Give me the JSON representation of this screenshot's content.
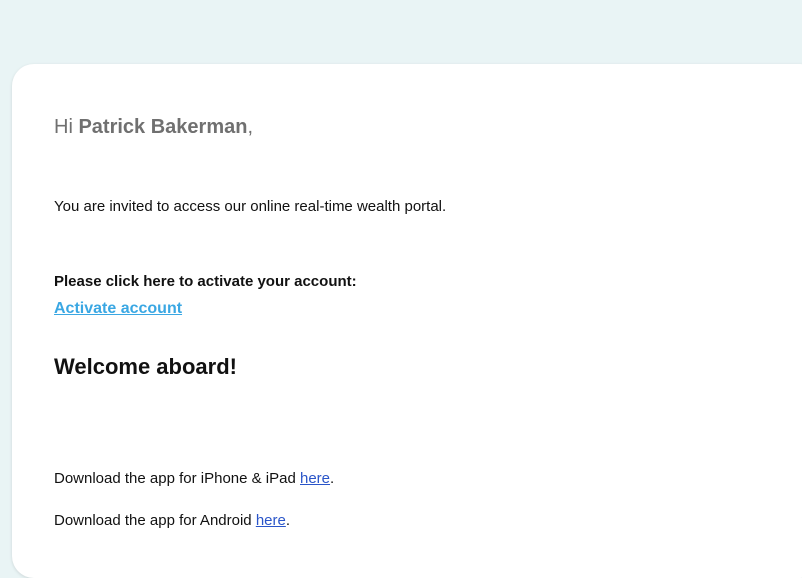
{
  "colors": {
    "background": "#e9f4f5",
    "card": "#ffffff",
    "greeting_text": "#707070",
    "body_text": "#111111",
    "activate_link": "#3aa7e3",
    "here_link": "#2a55c9"
  },
  "email": {
    "greeting_prefix": "Hi ",
    "recipient_name": "Patrick Bakerman",
    "greeting_suffix": ",",
    "invite_text": "You are invited to access our online real-time wealth portal.",
    "cta_label": "Please click here to activate your account:",
    "activate_link_text": "Activate account",
    "welcome_text": "Welcome aboard!",
    "ios_text": "Download the app for iPhone & iPad ",
    "ios_link_text": "here",
    "ios_suffix": ".",
    "android_text": "Download the app for Android ",
    "android_link_text": "here",
    "android_suffix": "."
  }
}
